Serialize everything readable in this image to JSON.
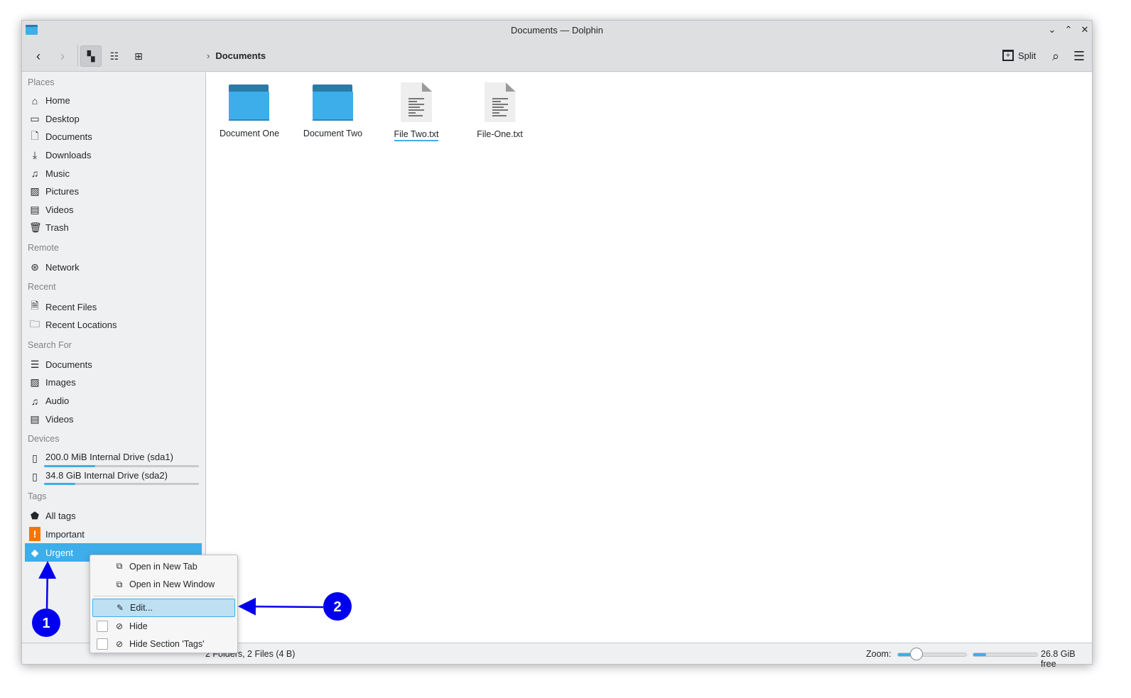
{
  "window": {
    "title": "Documents — Dolphin"
  },
  "toolbar": {
    "breadcrumb": "Documents",
    "split_label": "Split"
  },
  "sidebar": {
    "sections": [
      {
        "header": "Places",
        "items": [
          {
            "label": "Home",
            "icon": "home-icon"
          },
          {
            "label": "Desktop",
            "icon": "desktop-icon"
          },
          {
            "label": "Documents",
            "icon": "documents-icon"
          },
          {
            "label": "Downloads",
            "icon": "downloads-icon"
          },
          {
            "label": "Music",
            "icon": "music-icon"
          },
          {
            "label": "Pictures",
            "icon": "pictures-icon"
          },
          {
            "label": "Videos",
            "icon": "videos-icon"
          },
          {
            "label": "Trash",
            "icon": "trash-icon"
          }
        ]
      },
      {
        "header": "Remote",
        "items": [
          {
            "label": "Network",
            "icon": "network-icon"
          }
        ]
      },
      {
        "header": "Recent",
        "items": [
          {
            "label": "Recent Files",
            "icon": "recent-files-icon"
          },
          {
            "label": "Recent Locations",
            "icon": "recent-locations-icon"
          }
        ]
      },
      {
        "header": "Search For",
        "items": [
          {
            "label": "Documents",
            "icon": "documents-search-icon"
          },
          {
            "label": "Images",
            "icon": "images-icon"
          },
          {
            "label": "Audio",
            "icon": "audio-icon"
          },
          {
            "label": "Videos",
            "icon": "videos-icon"
          }
        ]
      },
      {
        "header": "Devices",
        "items": [
          {
            "label": "200.0 MiB Internal Drive (sda1)",
            "icon": "drive-icon",
            "usage": 0.33
          },
          {
            "label": "34.8 GiB Internal Drive (sda2)",
            "icon": "drive-icon",
            "usage": 0.2
          }
        ]
      },
      {
        "header": "Tags",
        "items": [
          {
            "label": "All tags",
            "icon": "tags-icon"
          },
          {
            "label": "Important",
            "icon": "important-icon"
          },
          {
            "label": "Urgent",
            "icon": "tag-icon",
            "selected": true
          }
        ]
      }
    ]
  },
  "files": [
    {
      "name": "Document One",
      "type": "folder"
    },
    {
      "name": "Document Two",
      "type": "folder"
    },
    {
      "name": "File Two.txt",
      "type": "text",
      "focused": true
    },
    {
      "name": "File-One.txt",
      "type": "text"
    }
  ],
  "context_menu": {
    "items": [
      "Open in New Tab",
      "Open in New Window",
      "Edit...",
      "Hide",
      "Hide Section 'Tags'"
    ]
  },
  "status": {
    "summary": "2 Folders, 2 Files (4 B)",
    "zoom_label": "Zoom:",
    "zoom_level": 0.25,
    "free_space": "26.8 GiB free",
    "used_fraction": 0.2
  },
  "annotations": [
    "1",
    "2"
  ],
  "colors": {
    "accent": "#3daee9",
    "annotation": "#0000ee"
  }
}
